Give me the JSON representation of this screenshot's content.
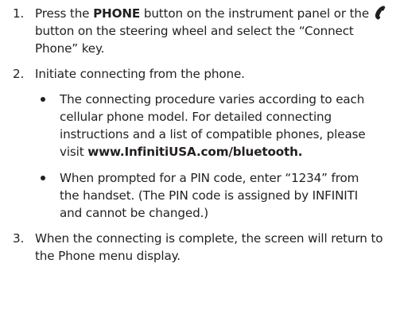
{
  "steps": [
    {
      "number": "1.",
      "text_1": "Press the ",
      "bold_1": "PHONE",
      "text_2": " button on the instrument panel or the ",
      "icon": "phone-handset-icon",
      "text_3": " button on the steering wheel and select the “Connect Phone” key."
    },
    {
      "number": "2.",
      "text": "Initiate connecting from the phone.",
      "bullets": [
        {
          "text": "The connecting procedure varies according to each cellular phone model. For detailed connecting instructions and a list of compatible phones, please visit ",
          "bold": "www.InfinitiUSA.com/bluetooth."
        },
        {
          "text": "When prompted for a PIN code, enter “1234” from the handset. (The PIN code is assigned by INFINITI and cannot be changed.)"
        }
      ]
    },
    {
      "number": "3.",
      "text": "When the connecting is complete, the screen will return to the Phone menu display."
    }
  ]
}
